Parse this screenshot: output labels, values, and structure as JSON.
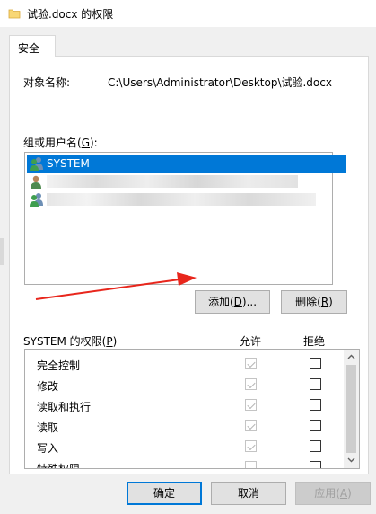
{
  "window": {
    "title": "试验.docx 的权限"
  },
  "tabs": [
    {
      "label": "安全"
    }
  ],
  "object": {
    "label": "对象名称:",
    "path": "C:\\Users\\Administrator\\Desktop\\试验.docx"
  },
  "groups": {
    "label_prefix": "组或用户名(",
    "label_key": "G",
    "label_suffix": "):",
    "items": [
      {
        "name": "SYSTEM",
        "selected": true,
        "icon": "user-group-icon"
      },
      {
        "name": "",
        "selected": false,
        "icon": "user-icon"
      },
      {
        "name": "",
        "selected": false,
        "icon": "user-group-icon"
      }
    ]
  },
  "buttons": {
    "add_prefix": "添加(",
    "add_key": "D",
    "add_suffix": ")...",
    "remove_prefix": "删除(",
    "remove_key": "R",
    "remove_suffix": ")",
    "ok": "确定",
    "cancel": "取消",
    "apply_prefix": "应用(",
    "apply_key": "A",
    "apply_suffix": ")"
  },
  "permissions": {
    "label_prefix": "SYSTEM 的权限(",
    "label_key": "P",
    "label_suffix": ")",
    "allow_header": "允许",
    "deny_header": "拒绝",
    "items": [
      {
        "name": "完全控制",
        "allow": true,
        "deny": false
      },
      {
        "name": "修改",
        "allow": true,
        "deny": false
      },
      {
        "name": "读取和执行",
        "allow": true,
        "deny": false
      },
      {
        "name": "读取",
        "allow": true,
        "deny": false
      },
      {
        "name": "写入",
        "allow": true,
        "deny": false
      },
      {
        "name": "特殊权限",
        "allow": false,
        "deny": false
      }
    ]
  },
  "colors": {
    "selection": "#0078d7",
    "annotation_arrow": "#e8261c",
    "folder_icon": "#f8d775"
  }
}
